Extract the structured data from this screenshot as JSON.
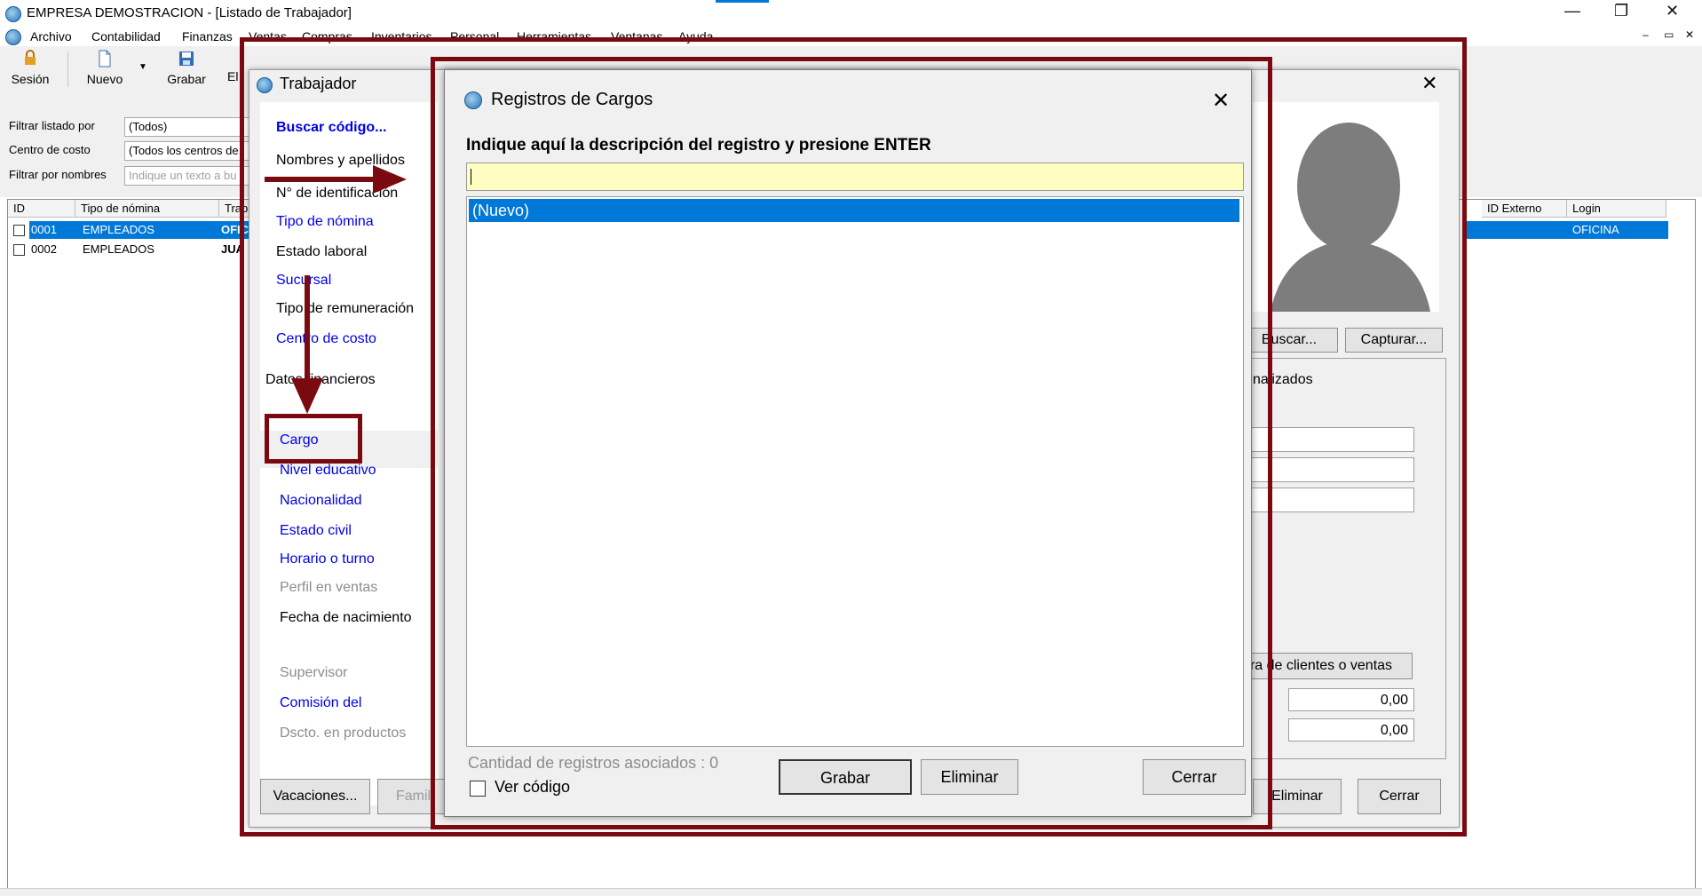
{
  "app": {
    "title": "EMPRESA DEMOSTRACION - [Listado de Trabajador]",
    "window_controls": {
      "minimize": "—",
      "restore": "❐",
      "close": "✕"
    },
    "mdi_controls": {
      "minimize": "–",
      "restore": "▭",
      "close": "✕"
    }
  },
  "menu": [
    "Archivo",
    "Contabilidad",
    "Finanzas",
    "Ventas",
    "Compras",
    "Inventarios",
    "Personal",
    "Herramientas",
    "Ventanas",
    "Ayuda"
  ],
  "toolbar": {
    "sesion": "Sesión",
    "nuevo": "Nuevo",
    "grabar": "Grabar",
    "eliminar_partial": "El"
  },
  "filters": {
    "filtrar_listado_label": "Filtrar listado por",
    "filtrar_listado_value": "(Todos)",
    "centro_costo_label": "Centro de costo",
    "centro_costo_value": "(Todos los centros de",
    "filtrar_nombres_label": "Filtrar por nombres",
    "filtrar_nombres_placeholder": "Indique un texto a bu"
  },
  "grid": {
    "headers": {
      "id": "ID",
      "tipo": "Tipo de nómina",
      "trab": "Trab",
      "id_externo": "ID Externo",
      "login": "Login"
    },
    "rows": [
      {
        "id": "0001",
        "tipo": "EMPLEADOS",
        "trab": "OFIC",
        "login": "OFICINA"
      },
      {
        "id": "0002",
        "tipo": "EMPLEADOS",
        "trab": "JUA",
        "login": ""
      }
    ]
  },
  "trabajador": {
    "title": "Trabajador",
    "buscar_codigo": "Buscar código...",
    "nombres": "Nombres y apellidos",
    "identificacion": "N° de identificación",
    "tipo_nomina": "Tipo de nómina",
    "estado_laboral": "Estado laboral",
    "sucursal": "Sucursal",
    "tipo_remuneracion": "Tipo de remuneración",
    "centro_costo": "Centro de costo",
    "datos_financieros": "Datos financieros",
    "cargo": "Cargo",
    "nivel_educativo": "Nivel educativo",
    "nacionalidad": "Nacionalidad",
    "estado_civil": "Estado civil",
    "horario": "Horario o turno",
    "perfil_ventas": "Perfil en ventas",
    "fecha_nacimiento": "Fecha de nacimiento",
    "supervisor": "Supervisor",
    "comision": "Comisión del",
    "dscto": "Dscto. en productos",
    "buscar_foto": "Buscar...",
    "capturar": "Capturar...",
    "tab_partial": "nalizados",
    "clientes_ventas_partial": "ra de clientes o ventas",
    "value1": "0,00",
    "value2": "0,00",
    "vacaciones": "Vacaciones...",
    "familia_partial": "Famili",
    "eliminar": "Eliminar",
    "cerrar": "Cerrar"
  },
  "registros": {
    "title": "Registros de Cargos",
    "instruction": "Indique aquí la descripción del registro y presione ENTER",
    "input_value": "",
    "items": [
      "(Nuevo)"
    ],
    "count_text": "Cantidad de registros asociados : 0",
    "ver_codigo": "Ver código",
    "grabar": "Grabar",
    "eliminar": "Eliminar",
    "cerrar": "Cerrar"
  },
  "colors": {
    "annotation": "#7a0a0f",
    "selection": "#0078d7",
    "input_highlight": "#fffdc2",
    "link_blue": "#0000e6"
  }
}
